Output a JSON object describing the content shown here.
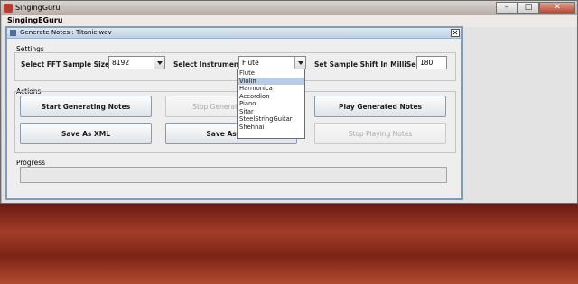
{
  "main_window": {
    "title": "SingingGuru",
    "minimize": "–",
    "maximize": "□",
    "close": "✕"
  },
  "menu": {
    "label": "SingingEGuru"
  },
  "dialog": {
    "title": "Generate Notes : Titanic.wav",
    "close": "✕"
  },
  "settings": {
    "section_label": "Settings",
    "fft_label": "Select FFT Sample Size :",
    "fft_value": "8192",
    "instrument_label": "Select Instrument :",
    "instrument_value": "Flute",
    "shift_label": "Set Sample Shift In MilliSecs :",
    "shift_value": "180"
  },
  "instrument_options": [
    "Flute",
    "Violin",
    "Harmonica",
    "Accordion",
    "Piano",
    "Sitar",
    "SteelStringGuitar",
    "Shehnai"
  ],
  "instrument_highlighted": "Violin",
  "actions": {
    "section_label": "Actions",
    "start": "Start Generating Notes",
    "stop": "Stop Generating Notes",
    "play": "Play Generated Notes",
    "save_xml": "Save As XML",
    "save_as": "Save As MIDI",
    "stop_playing": "Stop Playing Notes"
  },
  "progress": {
    "label": "Progress",
    "value": 0
  },
  "colors": {
    "accent_border": "#7f9db9",
    "selected_item": "#b8cde4",
    "close_button": "#c0452e"
  }
}
